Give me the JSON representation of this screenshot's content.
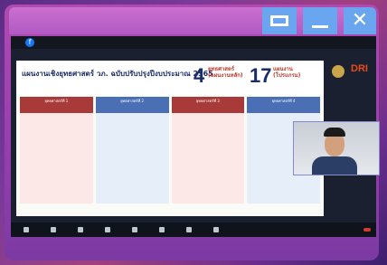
{
  "window": {
    "controls": [
      "maximize",
      "minimize",
      "close"
    ],
    "close_glyph": "✕"
  },
  "slide": {
    "title": "แผนงานเชิงยุทธศาสตร์ วภ. ฉบับปรับปรุงปีงบประมาณ 2565",
    "big_numbers": {
      "left_value": "4",
      "left_label_line1": "ยุทธศาสตร์",
      "left_label_line2": "(แผนงานหลัก)",
      "right_value": "17",
      "right_label_line1": "แผนงาน",
      "right_label_line2": "(โปรแกรม)"
    },
    "columns": [
      {
        "head": "ยุทธศาสตร์ที่ 1"
      },
      {
        "head": "ยุทธศาสตร์ที่ 2"
      },
      {
        "head": "ยุทธศาสตร์ที่ 3"
      },
      {
        "head": "ยุทธศาสตร์ที่ 4"
      }
    ]
  },
  "logos": {
    "right_brand": "DRI"
  },
  "toolbar": {
    "items": [
      "",
      "",
      "",
      "",
      "",
      "",
      "",
      "",
      ""
    ]
  },
  "colors": {
    "accent": "#6aa6ef",
    "frame": "#b04ab0",
    "slide_red": "#a83a3a",
    "slide_blue": "#4a6fb5"
  }
}
